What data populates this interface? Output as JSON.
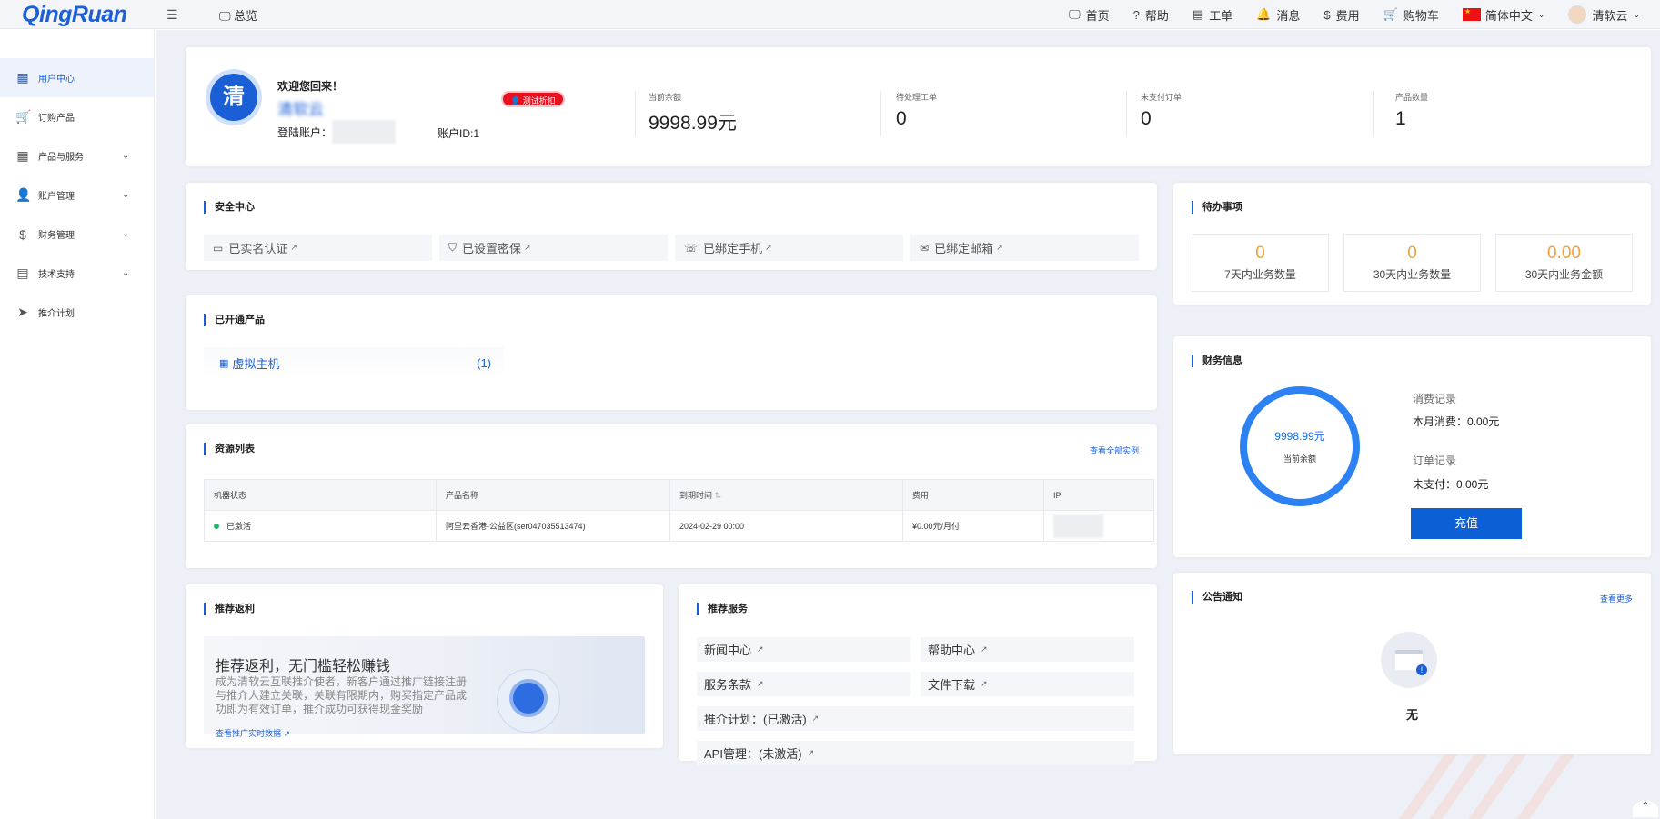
{
  "header": {
    "logo": "QingRuan",
    "overview": "总览",
    "nav": [
      {
        "icon": "monitor-icon",
        "glyph": "🖵",
        "label": "首页"
      },
      {
        "icon": "help-icon",
        "glyph": "?",
        "label": "帮助"
      },
      {
        "icon": "ticket-icon",
        "glyph": "▤",
        "label": "工单"
      },
      {
        "icon": "bell-icon",
        "glyph": "🔔",
        "label": "消息"
      },
      {
        "icon": "money-icon",
        "glyph": "$",
        "label": "费用"
      },
      {
        "icon": "cart-icon",
        "glyph": "🛒",
        "label": "购物车"
      }
    ],
    "language": "简体中文",
    "username": "清软云"
  },
  "sidebar": {
    "items": [
      {
        "label": "用户中心",
        "glyph": "▦",
        "icon": "grid-icon",
        "active": true,
        "arrow": false
      },
      {
        "label": "订购产品",
        "glyph": "🛒",
        "icon": "cart-icon",
        "arrow": false
      },
      {
        "label": "产品与服务",
        "glyph": "▦",
        "icon": "apps-icon",
        "arrow": true
      },
      {
        "label": "账户管理",
        "glyph": "👤",
        "icon": "user-icon",
        "arrow": true
      },
      {
        "label": "财务管理",
        "glyph": "$",
        "icon": "finance-icon",
        "arrow": true
      },
      {
        "label": "技术支持",
        "glyph": "▤",
        "icon": "support-icon",
        "arrow": true
      },
      {
        "label": "推介计划",
        "glyph": "➤",
        "icon": "send-icon",
        "arrow": false
      }
    ]
  },
  "welcome": {
    "avatar_char": "清",
    "greeting": "欢迎您回来！",
    "name": "清软云",
    "badge": "测试折扣",
    "login_label": "登陆账户：",
    "account_id": "账户ID:1",
    "stats": [
      {
        "label": "当前余额",
        "value": "9998.99元"
      },
      {
        "label": "待处理工单",
        "value": "0"
      },
      {
        "label": "未支付订单",
        "value": "0"
      },
      {
        "label": "产品数量",
        "value": "1"
      }
    ]
  },
  "security": {
    "title": "安全中心",
    "items": [
      {
        "icon": "id-card-icon",
        "glyph": "▭",
        "label": "已实名认证"
      },
      {
        "icon": "shield-icon",
        "glyph": "⛉",
        "label": "已设置密保"
      },
      {
        "icon": "phone-icon",
        "glyph": "☏",
        "label": "已绑定手机"
      },
      {
        "icon": "mail-icon",
        "glyph": "✉",
        "label": "已绑定邮箱"
      }
    ]
  },
  "todo": {
    "title": "待办事项",
    "items": [
      {
        "value": "0",
        "label": "7天内业务数量"
      },
      {
        "value": "0",
        "label": "30天内业务数量"
      },
      {
        "value": "0.00",
        "label": "30天内业务金额"
      }
    ]
  },
  "products": {
    "title": "已开通产品",
    "item": {
      "label": "虚拟主机",
      "count": "(1)"
    }
  },
  "finance": {
    "title": "财务信息",
    "ring_value": "9998.99元",
    "ring_label": "当前余额",
    "consume_title": "消费记录",
    "consume_text": "本月消费：0.00元",
    "order_title": "订单记录",
    "order_text": "未支付：0.00元",
    "recharge": "充值"
  },
  "resources": {
    "title": "资源列表",
    "view_all": "查看全部实例",
    "columns": [
      "机器状态",
      "产品名称",
      "到期时间",
      "费用",
      "IP"
    ],
    "rows": [
      {
        "status": "已激活",
        "name": "阿里云香港-公益区(ser047035513474)",
        "expire": "2024-02-29 00:00",
        "fee": "¥0.00元/月付"
      }
    ]
  },
  "notice": {
    "title": "公告通知",
    "more": "查看更多",
    "empty": "无"
  },
  "referral": {
    "title": "推荐返利",
    "headline": "推荐返利，无门槛轻松赚钱",
    "desc": "成为清软云互联推介使者，新客户通过推广链接注册与推介人建立关联，关联有限期内，购买指定产品成功即为有效订单，推介成功可获得现金奖励",
    "link": "查看推广实时数据"
  },
  "services": {
    "title": "推荐服务",
    "items": [
      "新闻中心",
      "帮助中心",
      "服务条款",
      "文件下载",
      "推介计划：(已激活)",
      "API管理：(未激活)"
    ]
  }
}
